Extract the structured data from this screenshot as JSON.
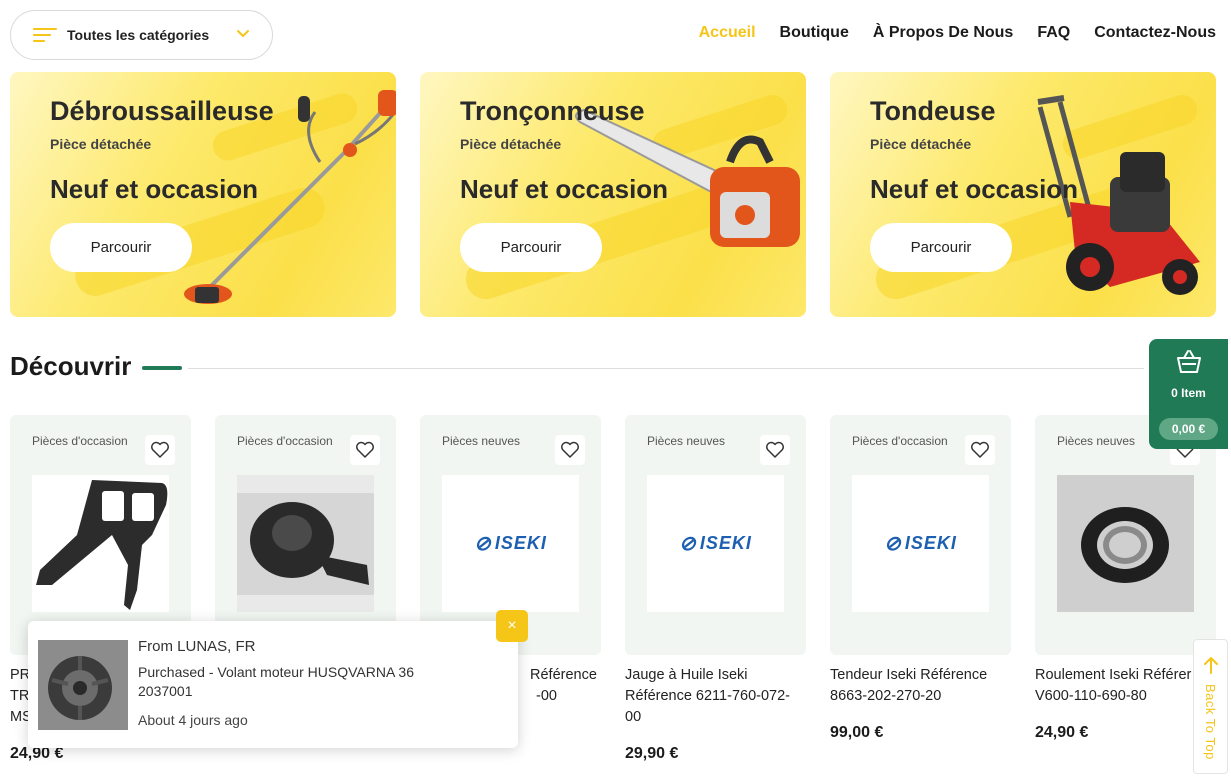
{
  "header": {
    "categories_label": "Toutes les catégories",
    "nav": [
      "Accueil",
      "Boutique",
      "À Propos De Nous",
      "FAQ",
      "Contactez-Nous"
    ]
  },
  "banners": [
    {
      "title": "Débroussailleuse",
      "subtitle": "Pièce détachée",
      "tagline": "Neuf et occasion",
      "button": "Parcourir"
    },
    {
      "title": "Tronçonneuse",
      "subtitle": "Pièce détachée",
      "tagline": "Neuf et occasion",
      "button": "Parcourir"
    },
    {
      "title": "Tondeuse",
      "subtitle": "Pièce détachée",
      "tagline": "Neuf et occasion",
      "button": "Parcourir"
    }
  ],
  "section": {
    "title": "Découvrir"
  },
  "products": [
    {
      "condition": "Pièces d'occasion",
      "name_lines": [
        "PR",
        "TR",
        "MS"
      ],
      "price": "24,90 €"
    },
    {
      "condition": "Pièces d'occasion",
      "name_lines": [],
      "price": ""
    },
    {
      "condition": "Pièces neuves",
      "name_lines": [
        "Référence",
        "-00"
      ],
      "price": ""
    },
    {
      "condition": "Pièces neuves",
      "name_lines": [
        "Jauge à Huile Iseki",
        "Référence 6211-760-072-",
        "00"
      ],
      "price": "29,90 €"
    },
    {
      "condition": "Pièces d'occasion",
      "name_lines": [
        "Tendeur Iseki Référence",
        "8663-202-270-20"
      ],
      "price": "99,00 €"
    },
    {
      "condition": "Pièces neuves",
      "name_lines": [
        "Roulement Iseki Référer",
        "V600-110-690-80"
      ],
      "price": "24,90 €"
    }
  ],
  "brand_logo_text": "ISEKI",
  "cart": {
    "count": "0 Item",
    "amount": "0,00 €"
  },
  "notification": {
    "from": "From LUNAS, FR",
    "purchased": "Purchased - Volant moteur HUSQVARNA 36 2037001",
    "when": "About 4 jours ago",
    "close": "×"
  },
  "back_to_top": "Back To Top",
  "colors": {
    "accent_yellow": "#f5c518",
    "brand_green": "#1f7a55",
    "card_bg": "#f1f6f2"
  }
}
